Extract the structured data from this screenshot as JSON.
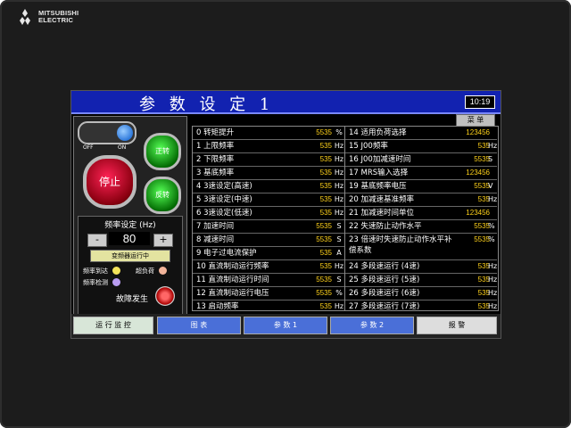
{
  "brand": {
    "name_line1": "MITSUBISHI",
    "name_line2": "ELECTRIC"
  },
  "titlebar": {
    "title": "参 数 设 定 1",
    "clock": "10:19"
  },
  "menu_label": "菜 单",
  "controls": {
    "off_label": "OFF",
    "on_label": "ON",
    "stop_label": "停止",
    "forward_label": "正转",
    "reverse_label": "反转"
  },
  "frequency": {
    "title": "频率设定 (Hz)",
    "minus": "-",
    "value": "80",
    "plus": "+",
    "run_button": "变频器运行中"
  },
  "indicators": {
    "freq_reached": "频率到达",
    "overload": "超负荷",
    "freq_detect": "频率检测",
    "fault": "故障发生"
  },
  "params_left": [
    {
      "name": "0 转矩提升",
      "value": "5535",
      "unit": "%"
    },
    {
      "name": "1 上限频率",
      "value": "535",
      "unit": "Hz"
    },
    {
      "name": "2 下限频率",
      "value": "535",
      "unit": "Hz"
    },
    {
      "name": "3 基底频率",
      "value": "535",
      "unit": "Hz"
    },
    {
      "name": "4 3速设定(高速)",
      "value": "535",
      "unit": "Hz"
    },
    {
      "name": "5 3速设定(中速)",
      "value": "535",
      "unit": "Hz"
    },
    {
      "name": "6 3速设定(低速)",
      "value": "535",
      "unit": "Hz"
    },
    {
      "name": "7 加速时间",
      "value": "5535",
      "unit": "S"
    },
    {
      "name": "8 减速时间",
      "value": "5535",
      "unit": "S"
    },
    {
      "name": "9 电子过电流保护",
      "value": "535",
      "unit": "A"
    },
    {
      "name": "10 直流制动运行频率",
      "value": "535",
      "unit": "Hz"
    },
    {
      "name": "11 直流制动运行时间",
      "value": "5535",
      "unit": "S"
    },
    {
      "name": "12 直流制动运行电压",
      "value": "5535",
      "unit": "%"
    },
    {
      "name": "13 启动频率",
      "value": "535",
      "unit": "Hz"
    }
  ],
  "params_right": [
    {
      "name": "14 适用负荷选择",
      "value": "123456",
      "unit": ""
    },
    {
      "name": "15 J00频率",
      "value": "535",
      "unit": "Hz"
    },
    {
      "name": "16 J00加减速时间",
      "value": "5535",
      "unit": "S"
    },
    {
      "name": "17 MRS输入选择",
      "value": "123456",
      "unit": ""
    },
    {
      "name": "19 基底频率电压",
      "value": "5535",
      "unit": "V"
    },
    {
      "name": "20 加减速基准频率",
      "value": "535",
      "unit": "Hz"
    },
    {
      "name": "21 加减速时间单位",
      "value": "123456",
      "unit": ""
    },
    {
      "name": "22 失速防止动作水平",
      "value": "5535",
      "unit": "%"
    },
    {
      "name": "23 倍速时失速防止动作水平补偿系数",
      "value": "5535",
      "unit": "%"
    },
    {
      "name": "24 多段速运行 (4速)",
      "value": "535",
      "unit": "Hz"
    },
    {
      "name": "25 多段速运行 (5速)",
      "value": "535",
      "unit": "Hz"
    },
    {
      "name": "26 多段速运行 (6速)",
      "value": "535",
      "unit": "Hz"
    },
    {
      "name": "27 多段速运行 (7速)",
      "value": "535",
      "unit": "Hz"
    }
  ],
  "nav": [
    {
      "label": "运 行 监 控"
    },
    {
      "label": "图 表"
    },
    {
      "label": "参 数 1"
    },
    {
      "label": "参 数 2"
    },
    {
      "label": "报 警"
    }
  ],
  "colors": {
    "title_bar": "#1222b0",
    "value_text": "#ffd21a",
    "nav_active": "#4a6fd8"
  }
}
